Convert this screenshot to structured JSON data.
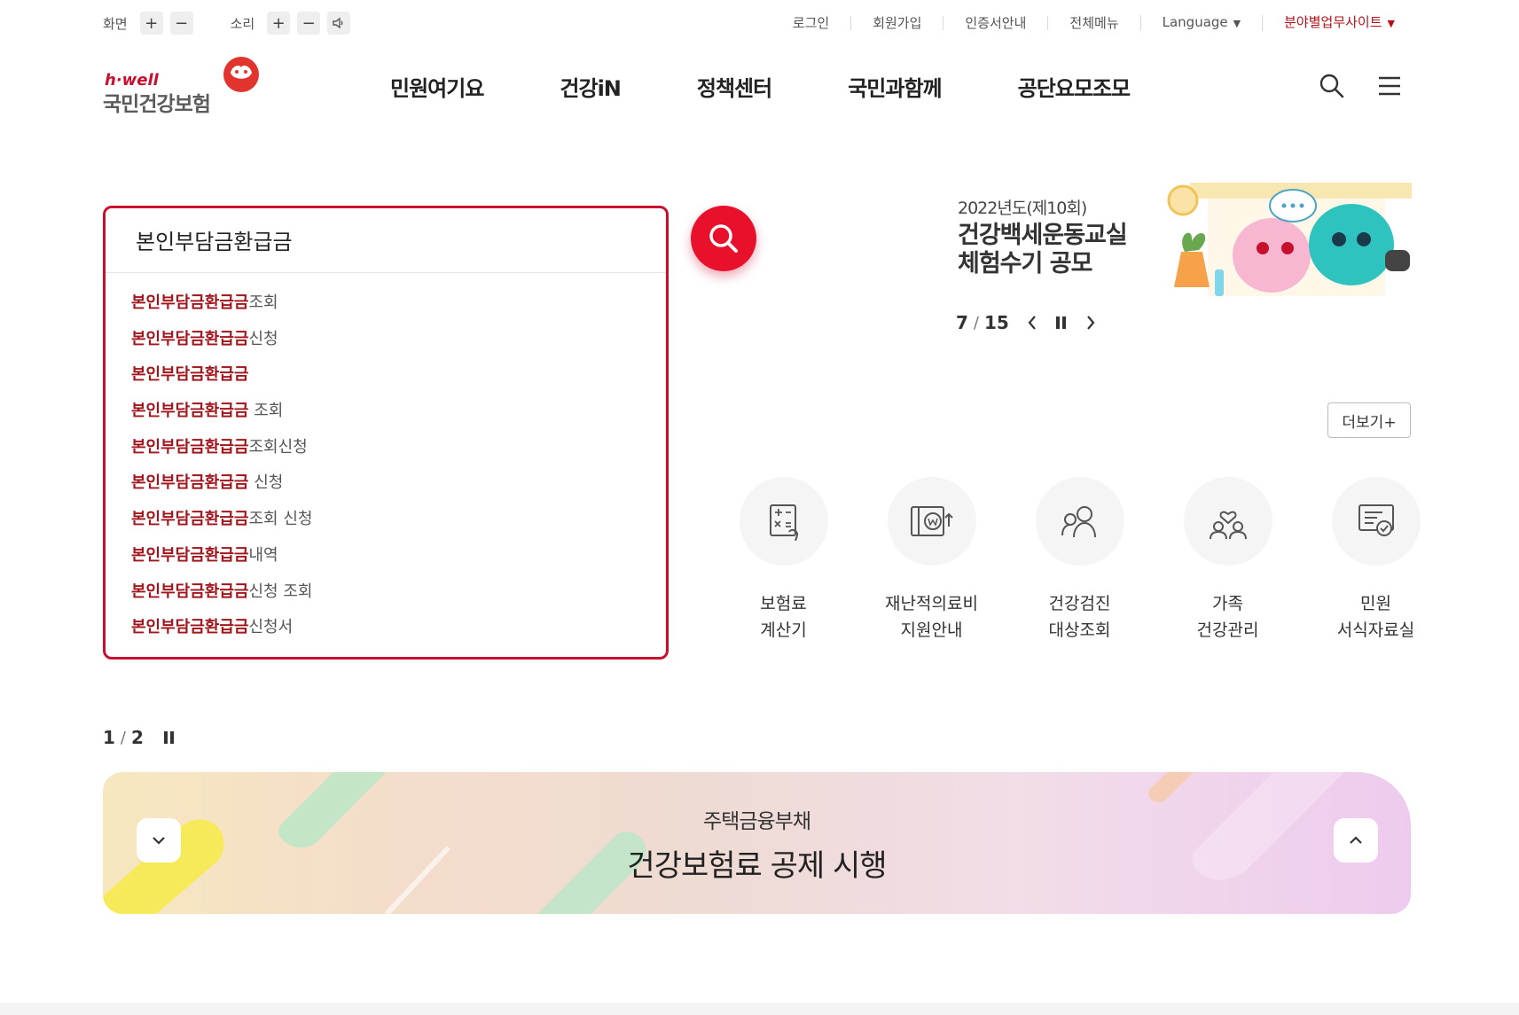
{
  "utility": {
    "screen_label": "화면",
    "sound_label": "소리",
    "plus": "+",
    "minus": "−",
    "links": [
      "로그인",
      "회원가입",
      "인증서안내",
      "전체메뉴"
    ],
    "language_label": "Language",
    "business_site_label": "분야별업무사이트",
    "caret": "▼"
  },
  "logo": {
    "tagline": "h·well",
    "name": "국민건강보험",
    "accent_color": "#c8102e"
  },
  "gnb": {
    "items": [
      "민원여기요",
      "건강iN",
      "정책센터",
      "국민과함께",
      "공단요모조모"
    ]
  },
  "header_icons": [
    "search-icon",
    "menu-icon"
  ],
  "search": {
    "query": "본인부담금환급금",
    "suggestions": [
      {
        "hl": "본인부담금환급금",
        "rest": "조회"
      },
      {
        "hl": "본인부담금환급금",
        "rest": "신청"
      },
      {
        "hl": "본인부담금환급금",
        "rest": ""
      },
      {
        "hl": "본인부담금환급금",
        "rest": " 조회"
      },
      {
        "hl": "본인부담금환급금",
        "rest": "조회신청"
      },
      {
        "hl": "본인부담금환급금",
        "rest": " 신청"
      },
      {
        "hl": "본인부담금환급금",
        "rest": "조회 신청"
      },
      {
        "hl": "본인부담금환급금",
        "rest": "내역"
      },
      {
        "hl": "본인부담금환급금",
        "rest": "신청 조회"
      },
      {
        "hl": "본인부담금환급금",
        "rest": "신청서"
      }
    ],
    "button_color": "#e8102b"
  },
  "banner": {
    "subtitle": "2022년도(제10회)",
    "title_line1": "건강백세운동교실",
    "title_line2": "체험수기 공모",
    "current": "7",
    "sep": "/",
    "total": "15"
  },
  "more_label": "더보기+",
  "quick_menu": [
    {
      "line1": "보험료",
      "line2": "계산기",
      "icon": "calculator-icon"
    },
    {
      "line1": "재난적의료비",
      "line2": "지원안내",
      "icon": "money-support-icon"
    },
    {
      "line1": "건강검진",
      "line2": "대상조회",
      "icon": "checkup-search-icon"
    },
    {
      "line1": "가족",
      "line2": "건강관리",
      "icon": "family-health-icon"
    },
    {
      "line1": "민원",
      "line2": "서식자료실",
      "icon": "document-form-icon"
    }
  ],
  "bottom_banner": {
    "current": "1",
    "sep": "/",
    "total": "2",
    "line1": "주택금융부채",
    "line2": "건강보험료 공제 시행"
  }
}
